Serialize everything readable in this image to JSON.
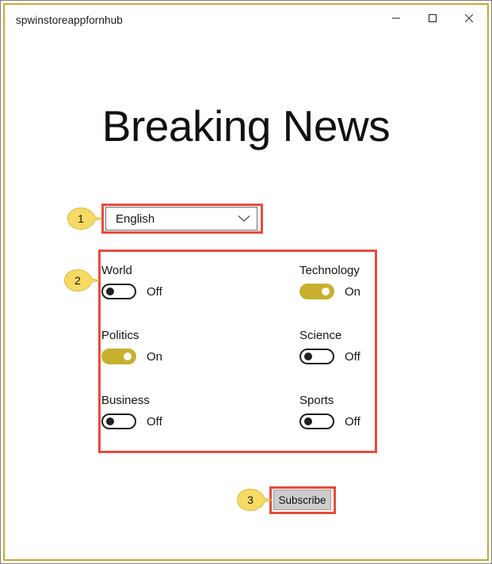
{
  "window": {
    "title": "spwinstoreappfornhub",
    "controls": [
      {
        "name": "minimize",
        "label": "Minimize"
      },
      {
        "name": "maximize",
        "label": "Maximize"
      },
      {
        "name": "close",
        "label": "Close"
      }
    ],
    "border_color": "#C8A92E"
  },
  "page": {
    "heading": "Breaking News"
  },
  "language_select": {
    "selected": "English",
    "icon": "chevron-down-icon"
  },
  "topics": [
    {
      "label": "World",
      "state": "Off",
      "on": false
    },
    {
      "label": "Technology",
      "state": "On",
      "on": true
    },
    {
      "label": "Politics",
      "state": "On",
      "on": true
    },
    {
      "label": "Science",
      "state": "Off",
      "on": false
    },
    {
      "label": "Business",
      "state": "Off",
      "on": false
    },
    {
      "label": "Sports",
      "state": "Off",
      "on": false
    }
  ],
  "subscribe": {
    "label": "Subscribe"
  },
  "annotations": {
    "highlight_color": "#E84B3C",
    "callout_fill": "#F7DA64",
    "callouts": [
      {
        "number": "1",
        "target": "language-dropdown"
      },
      {
        "number": "2",
        "target": "toggle-grid"
      },
      {
        "number": "3",
        "target": "subscribe-button"
      }
    ]
  }
}
